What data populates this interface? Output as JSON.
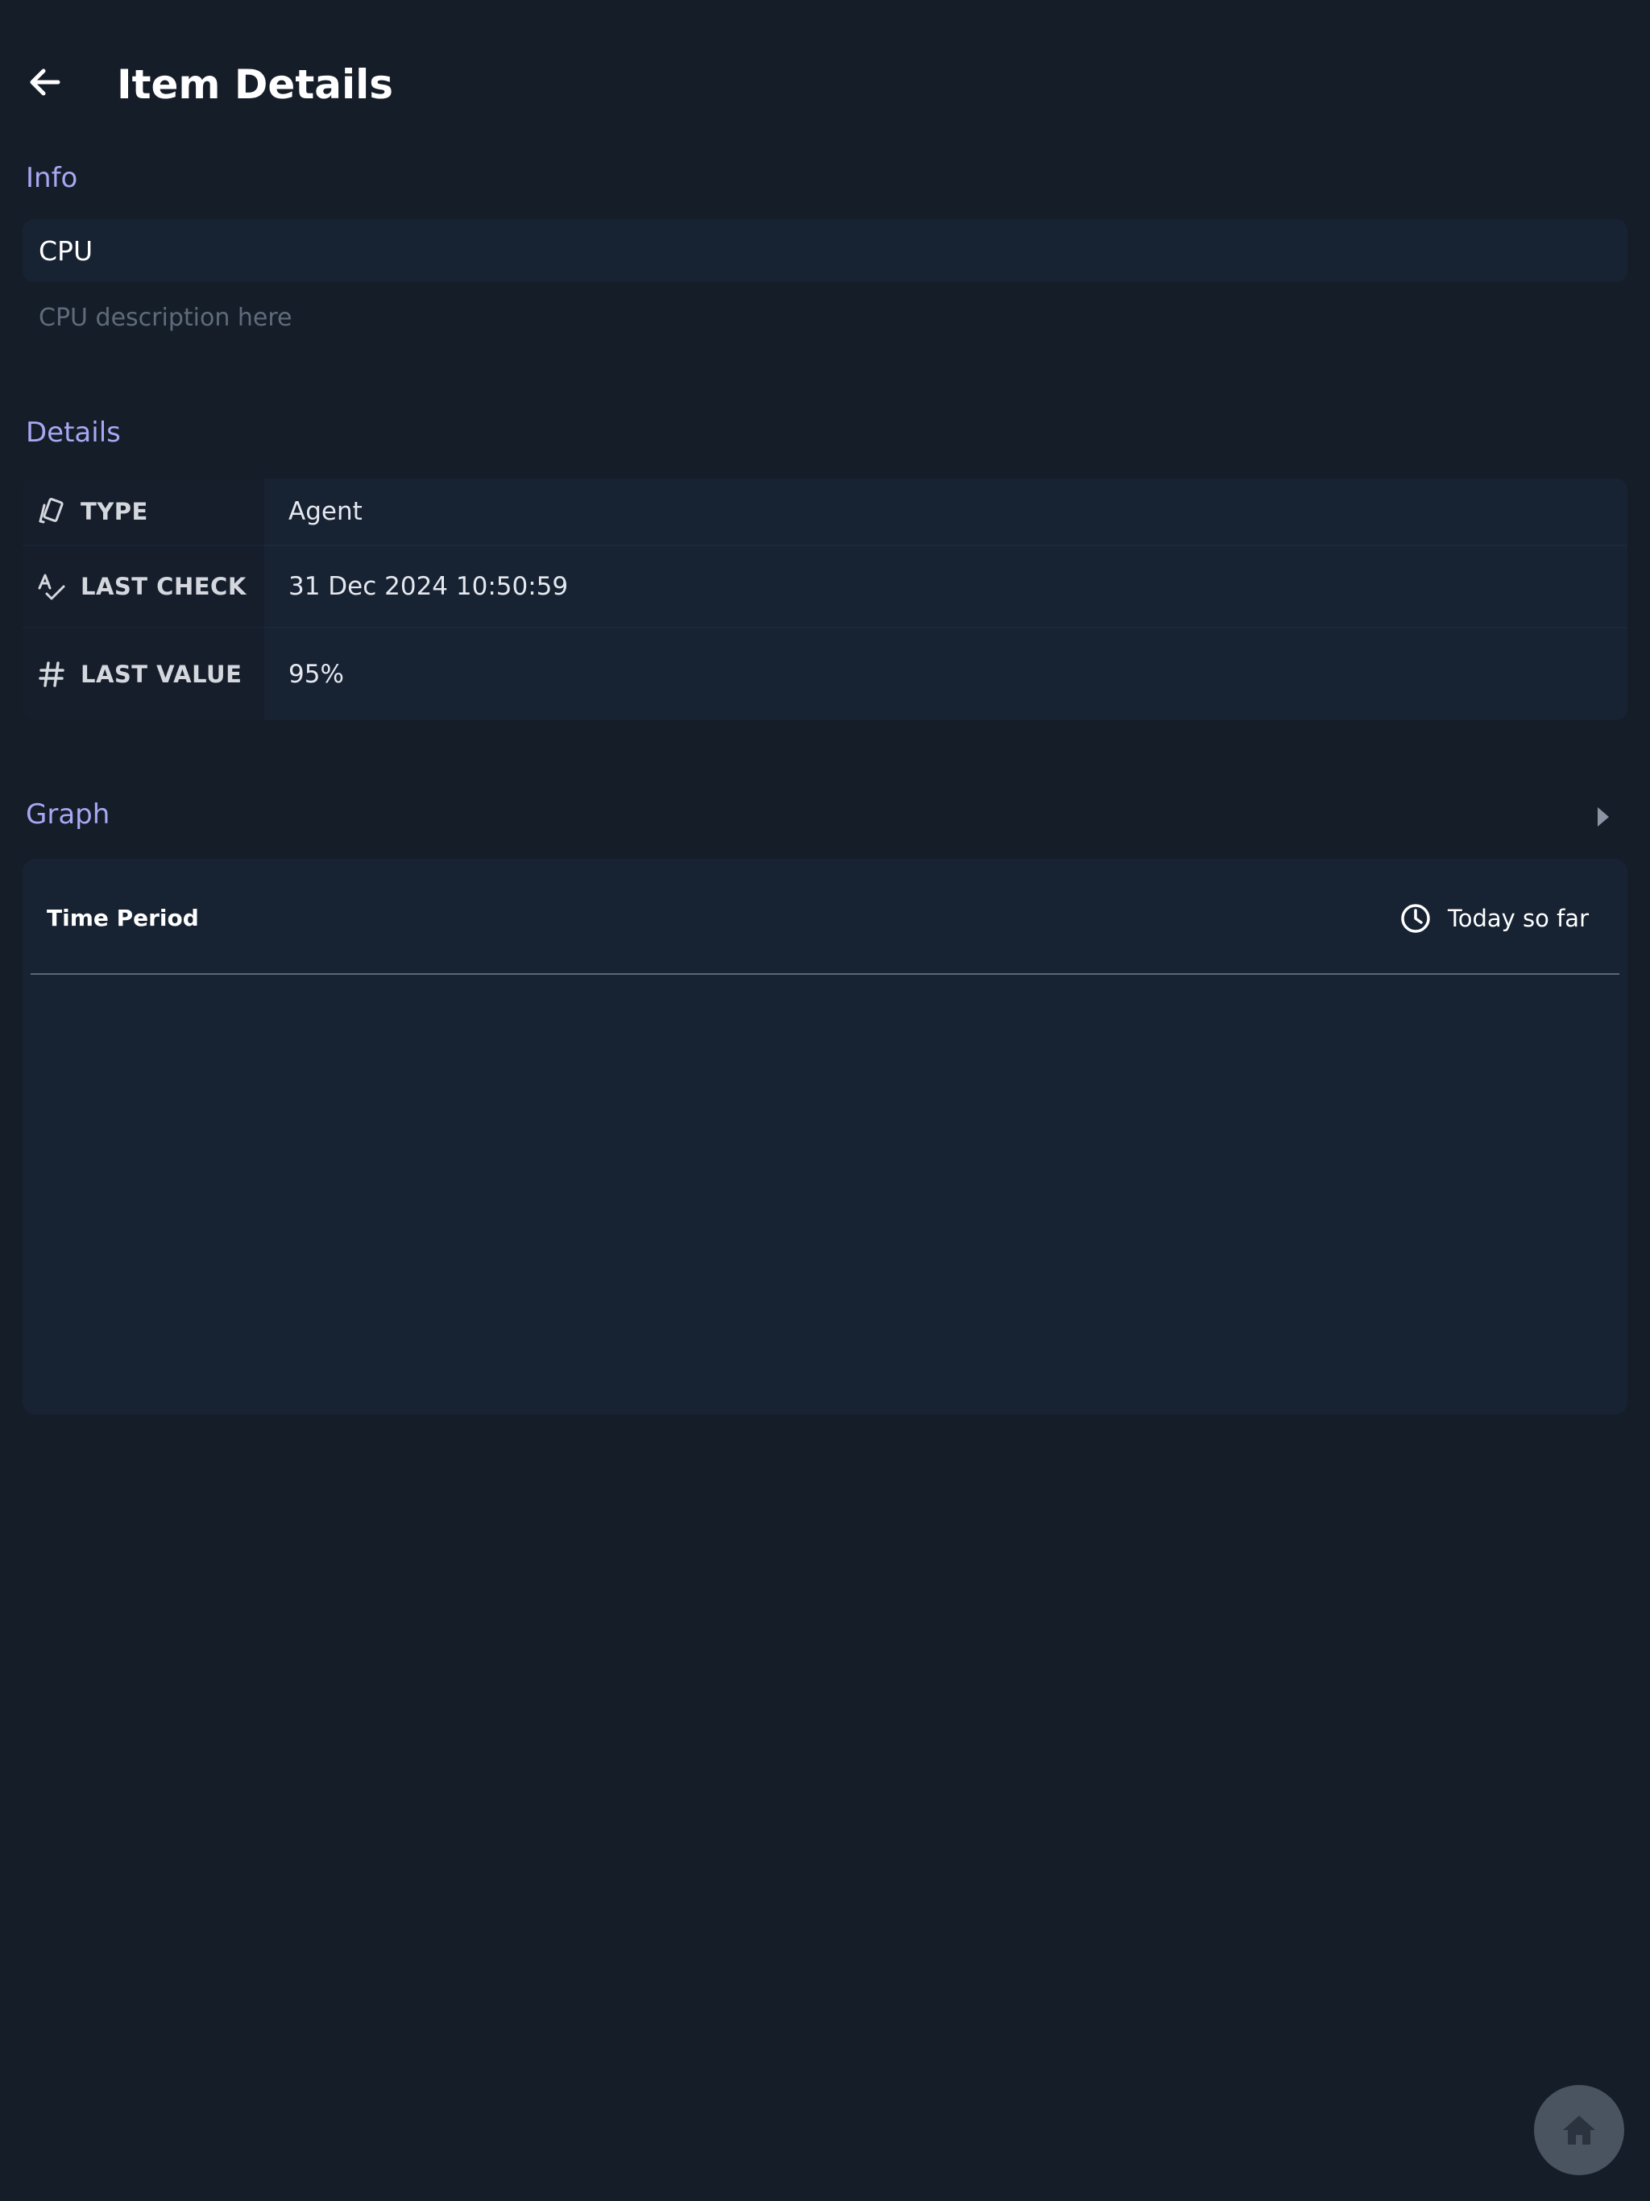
{
  "header": {
    "title": "Item Details"
  },
  "info": {
    "heading": "Info",
    "name": "CPU",
    "description": "CPU description here"
  },
  "details": {
    "heading": "Details",
    "rows": [
      {
        "icon": "tag-cards-icon",
        "label": "TYPE",
        "value": "Agent"
      },
      {
        "icon": "check-signature-icon",
        "label": "LAST CHECK",
        "value": "31 Dec 2024 10:50:59"
      },
      {
        "icon": "hash-icon",
        "label": "LAST VALUE",
        "value": "95%"
      }
    ]
  },
  "graph": {
    "heading": "Graph",
    "time_period_label": "Time Period",
    "time_period_value": "Today so far"
  },
  "colors": {
    "background": "#151d29",
    "card": "#172233",
    "accent": "#a7a8f2",
    "fab": "#4a5360"
  }
}
